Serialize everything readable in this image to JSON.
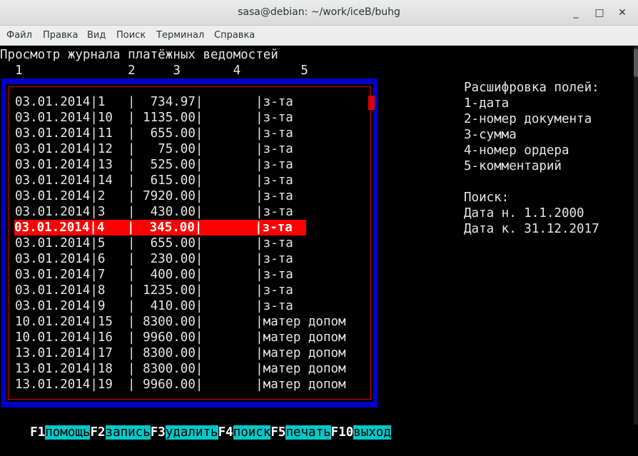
{
  "window": {
    "title": "sasa@debian: ~/work/iceB/buhg",
    "minimize": "_",
    "maximize": "□",
    "close": "✕"
  },
  "menu": [
    "Файл",
    "Правка",
    "Вид",
    "Поиск",
    "Терминал",
    "Справка"
  ],
  "screen": {
    "heading": "Просмотр журнала платёжных ведомостей",
    "column_numbers": "  1              2     3       4        5"
  },
  "rows": [
    "03.01.2014|1   |  734.97|       |з-та",
    "03.01.2014|10  | 1135.00|       |з-та",
    "03.01.2014|11  |  655.00|       |з-та",
    "03.01.2014|12  |   75.00|       |з-та",
    "03.01.2014|13  |  525.00|       |з-та",
    "03.01.2014|14  |  615.00|       |з-та",
    "03.01.2014|2   | 7920.00|       |з-та",
    "03.01.2014|3   |  430.00|       |з-та",
    "03.01.2014|4   |  345.00|       |з-та",
    "03.01.2014|5   |  655.00|       |з-та",
    "03.01.2014|6   |  230.00|       |з-та",
    "03.01.2014|7   |  400.00|       |з-та",
    "03.01.2014|8   | 1235.00|       |з-та",
    "03.01.2014|9   |  410.00|       |з-та",
    "10.01.2014|15  | 8300.00|       |матер допом",
    "10.01.2014|16  | 9960.00|       |матер допом",
    "13.01.2014|17  | 8300.00|       |матер допом",
    "13.01.2014|18  | 8300.00|       |матер допом",
    "13.01.2014|19  | 9960.00|       |матер допом"
  ],
  "selected_row_index": 8,
  "legend": {
    "title": "Расшифровка полей:",
    "items": [
      "1-дата",
      "2-номер документа",
      "3-сумма",
      "4-номер ордера",
      "5-комментарий"
    ]
  },
  "search": {
    "title": "Поиск:",
    "date_from": "Дата н. 1.1.2000",
    "date_to": "Дата к. 31.12.2017"
  },
  "fkeys": [
    {
      "key": "F1",
      "label": "помощь"
    },
    {
      "key": "F2",
      "label": "запись"
    },
    {
      "key": "F3",
      "label": "удалить"
    },
    {
      "key": "F4",
      "label": "поиск"
    },
    {
      "key": "F5",
      "label": "печать"
    },
    {
      "key": "F10",
      "label": "выход"
    }
  ]
}
